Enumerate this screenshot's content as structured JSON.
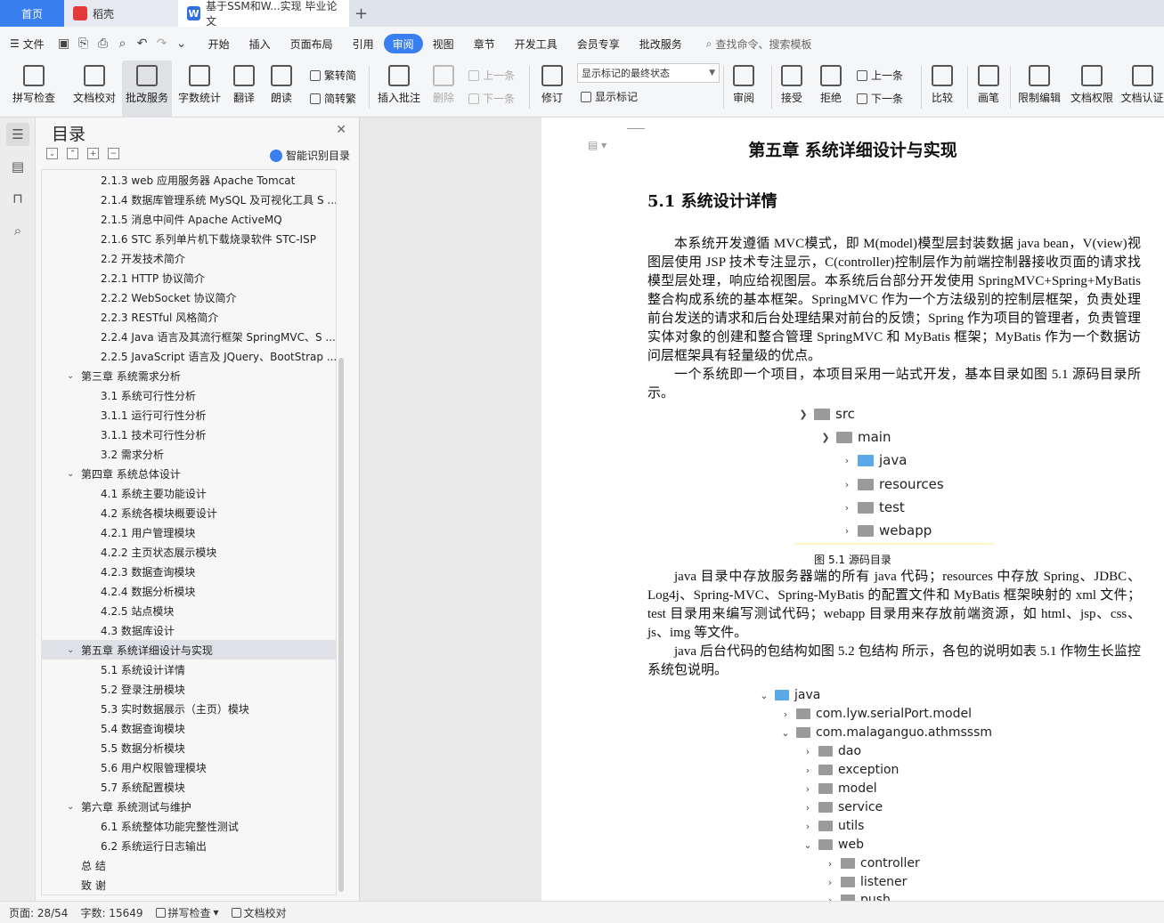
{
  "tabs": {
    "home": "首页",
    "daoke": "稻壳",
    "doc": "基于SSM和W...实现 毕业论文"
  },
  "menu": {
    "file": "文件",
    "items": [
      "开始",
      "插入",
      "页面布局",
      "引用",
      "审阅",
      "视图",
      "章节",
      "开发工具",
      "会员专享",
      "批改服务"
    ],
    "active": "审阅",
    "search": "查找命令、搜索模板"
  },
  "ribbon": {
    "spell": "拼写检查",
    "proof": "文档校对",
    "correct": "批改服务",
    "wordcount": "字数统计",
    "translate": "翻译",
    "read": "朗读",
    "trad": "繁转简",
    "simp": "简转繁",
    "insert_comment": "插入批注",
    "delete": "删除",
    "prev": "上一条",
    "next": "下一条",
    "revise": "修订",
    "combo": "显示标记的最终状态",
    "show_marks": "显示标记",
    "review": "审阅",
    "accept": "接受",
    "reject": "拒绝",
    "prev2": "上一条",
    "next2": "下一条",
    "compare": "比较",
    "pen": "画笔",
    "restrict": "限制编辑",
    "perm": "文档权限",
    "cert": "文档认证"
  },
  "toc": {
    "title": "目录",
    "smart": "智能识别目录",
    "items": [
      {
        "t": "2.1.3 web 应用服务器 Apache Tomcat",
        "l": "l2"
      },
      {
        "t": "2.1.4 数据库管理系统 MySQL 及可视化工具 S ...",
        "l": "l2"
      },
      {
        "t": "2.1.5 消息中间件 Apache ActiveMQ",
        "l": "l2"
      },
      {
        "t": "2.1.6 STC 系列单片机下载烧录软件 STC-ISP",
        "l": "l2"
      },
      {
        "t": "2.2  开发技术简介",
        "l": "l2"
      },
      {
        "t": "2.2.1 HTTP 协议简介",
        "l": "l2"
      },
      {
        "t": "2.2.2 WebSocket 协议简介",
        "l": "l2"
      },
      {
        "t": "2.2.3 RESTful 风格简介",
        "l": "l2"
      },
      {
        "t": "2.2.4 Java 语言及其流行框架 SpringMVC、S ...",
        "l": "l2"
      },
      {
        "t": "2.2.5 JavaScript 语言及 JQuery、BootStrap ...",
        "l": "l2"
      },
      {
        "t": "第三章  系统需求分析",
        "l": "l1"
      },
      {
        "t": "3.1  系统可行性分析",
        "l": "l2"
      },
      {
        "t": "3.1.1  运行可行性分析",
        "l": "l2"
      },
      {
        "t": "3.1.1  技术可行性分析",
        "l": "l2"
      },
      {
        "t": "3.2  需求分析",
        "l": "l2"
      },
      {
        "t": "第四章  系统总体设计",
        "l": "l1"
      },
      {
        "t": "4.1  系统主要功能设计",
        "l": "l2"
      },
      {
        "t": "4.2  系统各模块概要设计",
        "l": "l2"
      },
      {
        "t": "4.2.1  用户管理模块",
        "l": "l2"
      },
      {
        "t": "4.2.2  主页状态展示模块",
        "l": "l2"
      },
      {
        "t": "4.2.3  数据查询模块",
        "l": "l2"
      },
      {
        "t": "4.2.4  数据分析模块",
        "l": "l2"
      },
      {
        "t": "4.2.5  站点模块",
        "l": "l2"
      },
      {
        "t": "4.3  数据库设计",
        "l": "l2"
      },
      {
        "t": "第五章  系统详细设计与实现",
        "l": "l1",
        "cur": true
      },
      {
        "t": "5.1  系统设计详情",
        "l": "l2"
      },
      {
        "t": "5.2  登录注册模块",
        "l": "l2"
      },
      {
        "t": "5.3  实时数据展示（主页）模块",
        "l": "l2"
      },
      {
        "t": "5.4  数据查询模块",
        "l": "l2"
      },
      {
        "t": "5.5  数据分析模块",
        "l": "l2"
      },
      {
        "t": "5.6  用户权限管理模块",
        "l": "l2"
      },
      {
        "t": "5.7  系统配置模块",
        "l": "l2"
      },
      {
        "t": "第六章  系统测试与维护",
        "l": "l1"
      },
      {
        "t": "6.1  系统整体功能完整性测试",
        "l": "l2"
      },
      {
        "t": "6.2  系统运行日志输出",
        "l": "l2"
      },
      {
        "t": "总    结",
        "l": "l0"
      },
      {
        "t": "致    谢",
        "l": "l0"
      }
    ]
  },
  "doc": {
    "chapter": "第五章  系统详细设计与实现",
    "section": "5.1  系统设计详情",
    "p1": "本系统开发遵循 MVC模式，即 M(model)模型层封装数据 java bean，V(view)视图层使用 JSP 技术专注显示，C(controller)控制层作为前端控制器接收页面的请求找模型层处理，响应给视图层。本系统后台部分开发使用 SpringMVC+Spring+MyBatis 整合构成系统的基本框架。SpringMVC 作为一个方法级别的控制层框架，负责处理前台发送的请求和后台处理结果对前台的反馈；Spring 作为项目的管理者，负责管理实体对象的创建和整合管理 SpringMVC 和 MyBatis 框架；MyBatis 作为一个数据访问层框架具有轻量级的优点。",
    "p2": "一个系统即一个项目，本项目采用一站式开发，基本目录如图 5.1 源码目录所示。",
    "tree1": [
      "src",
      "main",
      "java",
      "resources",
      "test",
      "webapp"
    ],
    "caption": "图 5.1  源码目录",
    "p3": "java 目录中存放服务器端的所有 java 代码；resources 中存放 Spring、JDBC、Log4j、Spring-MVC、Spring-MyBatis 的配置文件和 MyBatis 框架映射的 xml 文件；test 目录用来编写测试代码；webapp 目录用来存放前端资源，如 html、jsp、css、js、img 等文件。",
    "p4": "java 后台代码的包结构如图 5.2  包结构  所示，各包的说明如表 5.1  作物生长监控系统包说明。",
    "tree2": [
      "java",
      "com.lyw.serialPort.model",
      "com.malaganguo.athmsssm",
      "dao",
      "exception",
      "model",
      "service",
      "utils",
      "web",
      "controller",
      "listener",
      "push"
    ]
  },
  "status": {
    "page": "页面: 28/54",
    "words": "字数: 15649",
    "spell": "拼写检查",
    "proof": "文档校对"
  }
}
